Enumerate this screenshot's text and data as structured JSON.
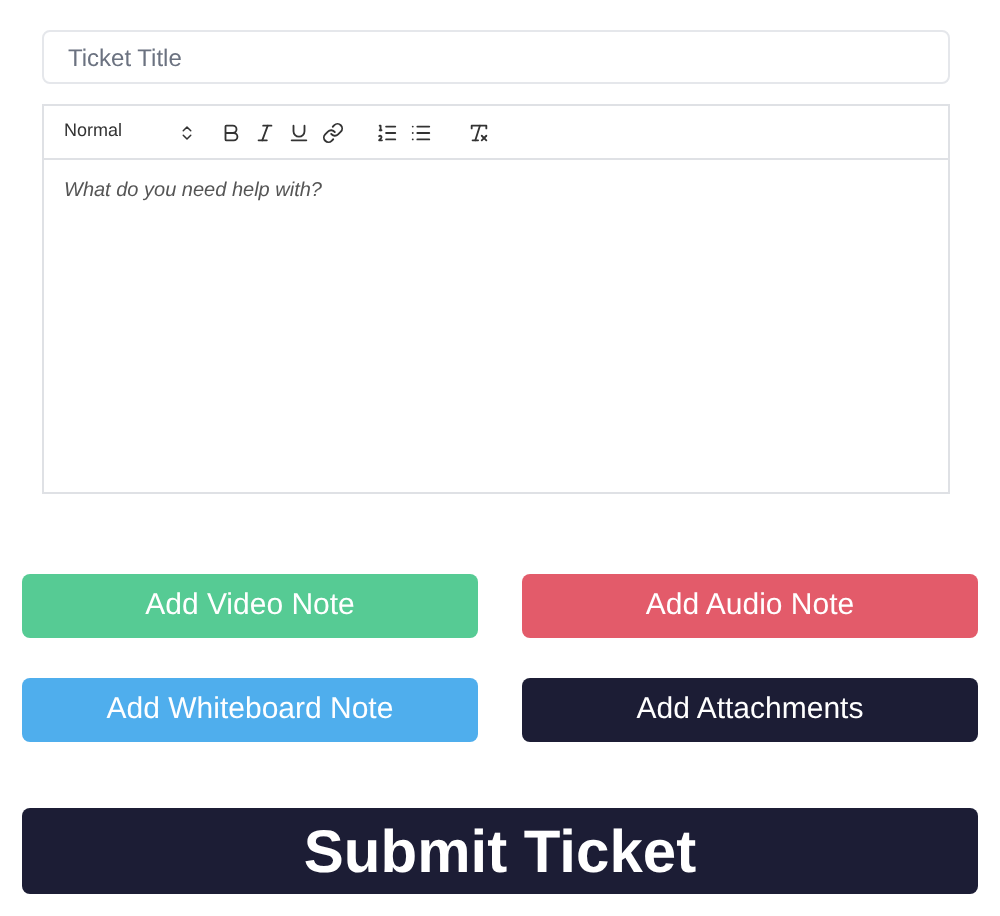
{
  "title_field": {
    "placeholder": "Ticket Title"
  },
  "editor": {
    "format_select": "Normal",
    "placeholder": "What do you need help with?"
  },
  "note_buttons": [
    {
      "label": "Add Video Note",
      "color": "#56cb94"
    },
    {
      "label": "Add Audio Note",
      "color": "#e35b6a"
    },
    {
      "label": "Add Whiteboard Note",
      "color": "#4faeed"
    },
    {
      "label": "Add Attachments",
      "color": "#1c1d35"
    }
  ],
  "submit_button": {
    "label": "Submit Ticket"
  }
}
